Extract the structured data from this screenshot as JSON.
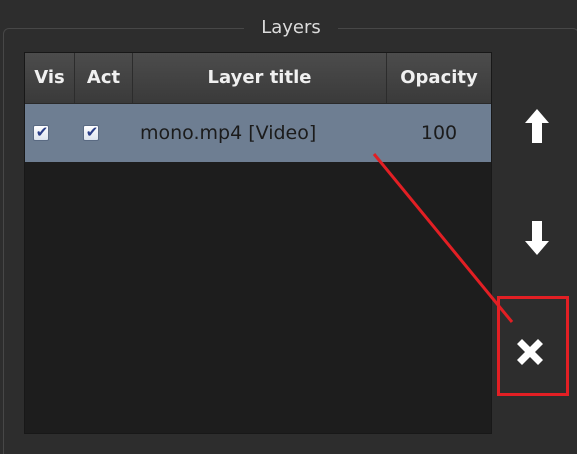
{
  "panel": {
    "title": "Layers"
  },
  "table": {
    "headers": {
      "vis": "Vis",
      "act": "Act",
      "title": "Layer title",
      "opacity": "Opacity"
    },
    "rows": [
      {
        "vis_checked": true,
        "act_checked": true,
        "title": "mono.mp4 [Video]",
        "opacity": "100",
        "selected": true
      }
    ]
  },
  "buttons": {
    "move_up_icon": "arrow-up-icon",
    "move_down_icon": "arrow-down-icon",
    "remove_icon": "close-icon"
  },
  "colors": {
    "panel_bg": "#2d2d2d",
    "table_bg": "#1d1d1d",
    "selected_row": "#6e7e92",
    "annotation": "#e21f24"
  }
}
